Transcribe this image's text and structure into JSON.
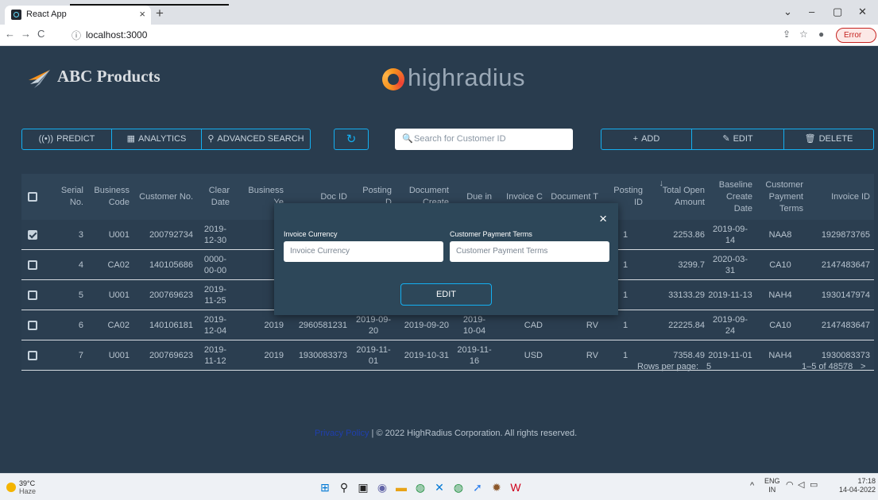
{
  "browser": {
    "tab_title": "React App",
    "tab_close": "×",
    "new_tab": "+",
    "url": "localhost:3000",
    "error_label": "Error",
    "window_controls": [
      "⌄",
      "–",
      "▢",
      "✕"
    ]
  },
  "app": {
    "brand": "ABC Products",
    "partner_logo": "highradius",
    "toolbar": {
      "predict": "PREDICT",
      "analytics": "ANALYTICS",
      "advanced_search": "ADVANCED SEARCH",
      "search_placeholder": "Search for Customer ID",
      "add": "ADD",
      "edit": "EDIT",
      "delete": "DELETE"
    },
    "columns": [
      "Serial No.",
      "Business Code",
      "Customer No.",
      "Clear Date",
      "Business Ye",
      "Doc ID",
      "Posting D",
      "Document Create",
      "Due in",
      "Invoice C",
      "Document T",
      "Posting ID",
      "Total Open Amount",
      "Baseline Create Date",
      "Customer Payment Terms",
      "Invoice ID"
    ],
    "sort_indicator": "↓",
    "rows": [
      {
        "checked": true,
        "cells": [
          "3",
          "U001",
          "200792734",
          "2019-12-30",
          "20",
          "",
          "",
          "",
          "",
          "",
          "",
          "1",
          "2253.86",
          "2019-09-14",
          "NAA8",
          "1929873765"
        ]
      },
      {
        "checked": false,
        "cells": [
          "4",
          "CA02",
          "140105686",
          "0000-00-00",
          "20",
          "",
          "",
          "",
          "",
          "",
          "",
          "1",
          "3299.7",
          "2020-03-31",
          "CA10",
          "2147483647"
        ]
      },
      {
        "checked": false,
        "cells": [
          "5",
          "U001",
          "200769623",
          "2019-11-25",
          "20",
          "",
          "",
          "",
          "",
          "",
          "",
          "1",
          "33133.29",
          "2019-11-13",
          "NAH4",
          "1930147974"
        ]
      },
      {
        "checked": false,
        "cells": [
          "6",
          "CA02",
          "140106181",
          "2019-12-04",
          "2019",
          "2960581231",
          "2019-09-20",
          "2019-09-20",
          "2019-10-04",
          "CAD",
          "RV",
          "1",
          "22225.84",
          "2019-09-24",
          "CA10",
          "2147483647"
        ]
      },
      {
        "checked": false,
        "cells": [
          "7",
          "U001",
          "200769623",
          "2019-11-12",
          "2019",
          "1930083373",
          "2019-11-01",
          "2019-10-31",
          "2019-11-16",
          "USD",
          "RV",
          "1",
          "7358.49",
          "2019-11-01",
          "NAH4",
          "1930083373"
        ]
      }
    ],
    "pagination": {
      "rows_per_page_label": "Rows per page:",
      "rows_per_page": "5",
      "range": "1–5 of 48578"
    },
    "footer": {
      "privacy_link": "Privacy Policy",
      "copyright": "| © 2022 HighRadius Corporation. All rights reserved."
    },
    "modal": {
      "field1_label": "Invoice Currency",
      "field1_placeholder": "Invoice Currency",
      "field2_label": "Customer Payment Terms",
      "field2_placeholder": "Customer Payment Terms",
      "submit": "EDIT",
      "close": "×"
    }
  },
  "taskbar": {
    "temperature": "39°C",
    "weather": "Haze",
    "lang_top": "ENG",
    "lang_bottom": "IN",
    "time": "17:18",
    "date": "14-04-2022"
  },
  "colors": {
    "app_bg": "#293c4e",
    "accent": "#14aff1",
    "modal_bg": "#2d4759"
  }
}
